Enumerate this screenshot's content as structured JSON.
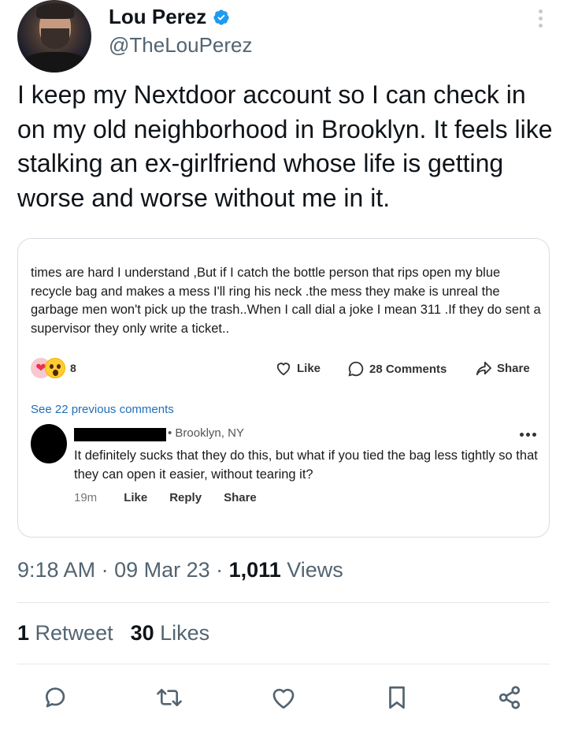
{
  "author": {
    "display_name": "Lou Perez",
    "handle": "@TheLouPerez",
    "verified": true
  },
  "tweet": {
    "text": "I keep my Nextdoor account so I can check in on my old neighborhood in Brooklyn. It feels like stalking an ex-girlfriend whose life is getting worse and worse without me in it."
  },
  "embedded_post": {
    "text": "times are hard I understand ,But if I catch the bottle  person that rips open my blue recycle bag and makes a mess I'll ring his neck .the mess they make is unreal the garbage men won't pick up the trash..When I call dial a joke I mean 311 .If they do sent a supervisor they only write a ticket..",
    "reaction_count": "8",
    "like_label": "Like",
    "comments_label": "28 Comments",
    "share_label": "Share",
    "see_previous_label": "See 22 previous comments",
    "comment": {
      "location": "• Brooklyn, NY",
      "text": "It definitely sucks that they do this, but what if you tied the bag less tightly so that they can open it easier, without tearing it?",
      "time": "19m",
      "like_label": "Like",
      "reply_label": "Reply",
      "share_label": "Share"
    }
  },
  "meta": {
    "time": "9:18 AM",
    "sep1": " · ",
    "date": "09 Mar 23",
    "sep2": " · ",
    "views_count": "1,011",
    "views_label": " Views"
  },
  "stats": {
    "retweets_count": "1",
    "retweets_label": " Retweet",
    "likes_count": "30",
    "likes_label": " Likes"
  },
  "colors": {
    "accent": "#1d9bf0",
    "secondary_text": "#536471",
    "icon": "#536471"
  },
  "icons": [
    "more-vertical-icon",
    "verified-badge-icon",
    "heart-icon",
    "comment-bubble-icon",
    "share-arrow-icon",
    "reply-icon",
    "retweet-icon",
    "like-icon",
    "bookmark-icon",
    "share-icon"
  ]
}
